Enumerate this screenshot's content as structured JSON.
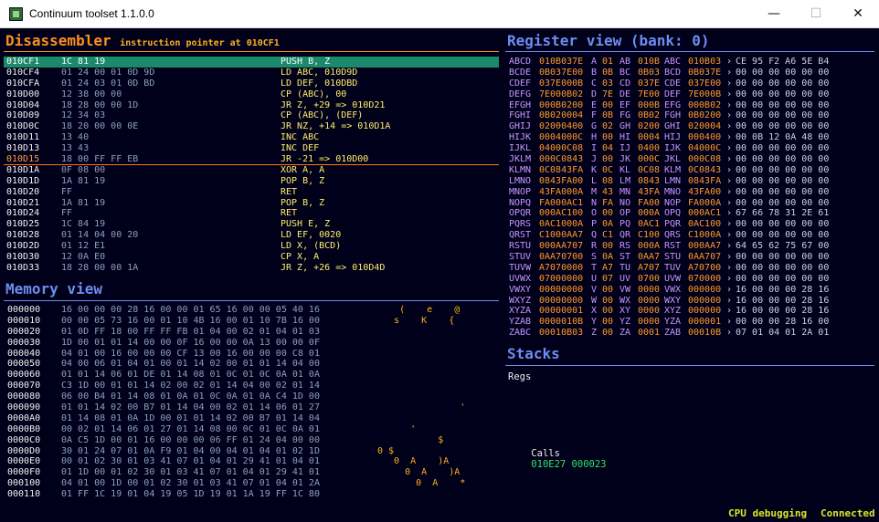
{
  "window": {
    "title": "Continuum toolset 1.1.0.0",
    "minimize_glyph": "—",
    "maximize_glyph": "☐",
    "close_glyph": "✕"
  },
  "disassembler": {
    "title": "Disassembler",
    "subtitle": "instruction pointer at 010CF1",
    "rows": [
      {
        "addr": "010CF1",
        "bytes": "1C 81 19",
        "instr": "PUSH B, Z"
      },
      {
        "addr": "010CF4",
        "bytes": "01 24 00 01 0D 9D",
        "instr": "LD ABC, 010D9D"
      },
      {
        "addr": "010CFA",
        "bytes": "01 24 03 01 0D BD",
        "instr": "LD DEF, 010DBD"
      },
      {
        "addr": "010D00",
        "bytes": "12 38 00 00",
        "instr": "CP (ABC), 00"
      },
      {
        "addr": "010D04",
        "bytes": "18 28 00 00 1D",
        "instr": "JR Z, +29 => 010D21"
      },
      {
        "addr": "010D09",
        "bytes": "12 34 03",
        "instr": "CP (ABC), (DEF)"
      },
      {
        "addr": "010D0C",
        "bytes": "18 20 00 00 0E",
        "instr": "JR NZ, +14 => 010D1A"
      },
      {
        "addr": "010D11",
        "bytes": "13 40",
        "instr": "INC ABC"
      },
      {
        "addr": "010D13",
        "bytes": "13 43",
        "instr": "INC DEF"
      },
      {
        "addr": "010D15",
        "bytes": "18 00 FF FF EB",
        "instr": "JR -21 => 010D00"
      },
      {
        "addr": "010D1A",
        "bytes": "0F 08 00",
        "instr": "XOR A, A"
      },
      {
        "addr": "010D1D",
        "bytes": "1A 81 19",
        "instr": "POP B, Z"
      },
      {
        "addr": "010D20",
        "bytes": "FF",
        "instr": "RET"
      },
      {
        "addr": "010D21",
        "bytes": "1A 81 19",
        "instr": "POP B, Z"
      },
      {
        "addr": "010D24",
        "bytes": "FF",
        "instr": "RET"
      },
      {
        "addr": "010D25",
        "bytes": "1C 84 19",
        "instr": "PUSH E, Z"
      },
      {
        "addr": "010D28",
        "bytes": "01 14 04 00 20",
        "instr": "LD EF, 0020"
      },
      {
        "addr": "010D2D",
        "bytes": "01 12 E1",
        "instr": "LD X, (BCD)"
      },
      {
        "addr": "010D30",
        "bytes": "12 0A E0",
        "instr": "CP X, A"
      },
      {
        "addr": "010D33",
        "bytes": "18 28 00 00 1A",
        "instr": "JR Z, +26 => 010D4D"
      }
    ]
  },
  "memory": {
    "title": "Memory view",
    "rows": [
      {
        "addr": "000000",
        "bytes": "16 00 00 00 28 16 00 00 01 65 16 00 00 05 40 16",
        "ascii": "    (    e    @ "
      },
      {
        "addr": "000010",
        "bytes": "00 00 05 73 16 00 01 10 4B 16 00 01 10 7B 16 00",
        "ascii": "   s    K    {  "
      },
      {
        "addr": "000020",
        "bytes": "01 0D FF 18 00 FF FF FB 01 04 00 02 01 04 01 03",
        "ascii": "                "
      },
      {
        "addr": "000030",
        "bytes": "1D 00 01 01 14 00 00 0F 16 00 00 0A 13 00 00 0F",
        "ascii": "                "
      },
      {
        "addr": "000040",
        "bytes": "04 01 00 16 00 00 00 CF 13 00 16 00 00 00 C8 01",
        "ascii": "                "
      },
      {
        "addr": "000050",
        "bytes": "04 00 06 01 04 01 00 01 14 02 00 01 01 14 04 00",
        "ascii": "                "
      },
      {
        "addr": "000060",
        "bytes": "01 01 14 06 01 DE 01 14 08 01 0C 01 0C 0A 01 0A",
        "ascii": "                "
      },
      {
        "addr": "000070",
        "bytes": "C3 1D 00 01 01 14 02 00 02 01 14 04 00 02 01 14",
        "ascii": "                "
      },
      {
        "addr": "000080",
        "bytes": "06 00 B4 01 14 08 01 0A 01 0C 0A 01 0A C4 1D 00",
        "ascii": "                "
      },
      {
        "addr": "000090",
        "bytes": "01 01 14 02 00 B7 01 14 04 00 02 01 14 06 01 27",
        "ascii": "               '"
      },
      {
        "addr": "0000A0",
        "bytes": "01 14 08 01 0A 1D 00 01 01 14 02 00 B7 01 14 04",
        "ascii": "                "
      },
      {
        "addr": "0000B0",
        "bytes": "00 02 01 14 06 01 27 01 14 08 00 0C 01 0C 0A 01",
        "ascii": "      '         "
      },
      {
        "addr": "0000C0",
        "bytes": "0A C5 1D 00 01 16 00 00 00 06 FF 01 24 04 00 00",
        "ascii": "           $    "
      },
      {
        "addr": "0000D0",
        "bytes": "30 01 24 07 01 0A F9 01 04 00 04 01 04 01 02 1D",
        "ascii": "0 $             "
      },
      {
        "addr": "0000E0",
        "bytes": "00 01 02 30 01 03 41 07 01 04 01 29 41 01 04 01",
        "ascii": "   0  A    )A   "
      },
      {
        "addr": "0000F0",
        "bytes": "01 1D 00 01 02 30 01 03 41 07 01 04 01 29 41 01",
        "ascii": "     0  A    )A "
      },
      {
        "addr": "000100",
        "bytes": "04 01 00 1D 00 01 02 30 01 03 41 07 01 04 01 2A",
        "ascii": "       0  A    *"
      },
      {
        "addr": "000110",
        "bytes": "01 FF 1C 19 01 04 19 05 1D 19 01 1A 19 FF 1C 80",
        "ascii": "                "
      }
    ]
  },
  "registers": {
    "title": "Register view (bank: 0)",
    "rows": [
      {
        "a": "ABCD",
        "av": "010B037E",
        "b": "A",
        "bv": "01",
        "c": "AB",
        "cv": "010B",
        "d": "ABC",
        "dv": "010B03",
        "bin": "CE 95 F2 A6 5E B4"
      },
      {
        "a": "BCDE",
        "av": "0B037E00",
        "b": "B",
        "bv": "0B",
        "c": "BC",
        "cv": "0B03",
        "d": "BCD",
        "dv": "0B037E",
        "bin": "00 00 00 00 00 00"
      },
      {
        "a": "CDEF",
        "av": "037E000B",
        "b": "C",
        "bv": "03",
        "c": "CD",
        "cv": "037E",
        "d": "CDE",
        "dv": "037E00",
        "bin": "00 00 00 00 00 00"
      },
      {
        "a": "DEFG",
        "av": "7E000B02",
        "b": "D",
        "bv": "7E",
        "c": "DE",
        "cv": "7E00",
        "d": "DEF",
        "dv": "7E000B",
        "bin": "00 00 00 00 00 00"
      },
      {
        "a": "EFGH",
        "av": "000B0200",
        "b": "E",
        "bv": "00",
        "c": "EF",
        "cv": "000B",
        "d": "EFG",
        "dv": "000B02",
        "bin": "00 00 00 00 00 00"
      },
      {
        "a": "FGHI",
        "av": "0B020004",
        "b": "F",
        "bv": "0B",
        "c": "FG",
        "cv": "0B02",
        "d": "FGH",
        "dv": "0B0200",
        "bin": "00 00 00 00 00 00"
      },
      {
        "a": "GHIJ",
        "av": "02000400",
        "b": "G",
        "bv": "02",
        "c": "GH",
        "cv": "0200",
        "d": "GHI",
        "dv": "020004",
        "bin": "00 00 00 00 00 00"
      },
      {
        "a": "HIJK",
        "av": "0004000C",
        "b": "H",
        "bv": "00",
        "c": "HI",
        "cv": "0004",
        "d": "HIJ",
        "dv": "000400",
        "bin": "00 0B 12 0A 48 00"
      },
      {
        "a": "IJKL",
        "av": "04000C08",
        "b": "I",
        "bv": "04",
        "c": "IJ",
        "cv": "0400",
        "d": "IJK",
        "dv": "04000C",
        "bin": "00 00 00 00 00 00"
      },
      {
        "a": "JKLM",
        "av": "000C0843",
        "b": "J",
        "bv": "00",
        "c": "JK",
        "cv": "000C",
        "d": "JKL",
        "dv": "000C08",
        "bin": "00 00 00 00 00 00"
      },
      {
        "a": "KLMN",
        "av": "0C0843FA",
        "b": "K",
        "bv": "0C",
        "c": "KL",
        "cv": "0C08",
        "d": "KLM",
        "dv": "0C0843",
        "bin": "00 00 00 00 00 00"
      },
      {
        "a": "LMNO",
        "av": "0843FA00",
        "b": "L",
        "bv": "08",
        "c": "LM",
        "cv": "0843",
        "d": "LMN",
        "dv": "0843FA",
        "bin": "00 00 00 00 00 00"
      },
      {
        "a": "MNOP",
        "av": "43FA000A",
        "b": "M",
        "bv": "43",
        "c": "MN",
        "cv": "43FA",
        "d": "MNO",
        "dv": "43FA00",
        "bin": "00 00 00 00 00 00"
      },
      {
        "a": "NOPQ",
        "av": "FA000AC1",
        "b": "N",
        "bv": "FA",
        "c": "NO",
        "cv": "FA00",
        "d": "NOP",
        "dv": "FA000A",
        "bin": "00 00 00 00 00 00"
      },
      {
        "a": "OPQR",
        "av": "000AC100",
        "b": "O",
        "bv": "00",
        "c": "OP",
        "cv": "000A",
        "d": "OPQ",
        "dv": "000AC1",
        "bin": "67 66 78 31 2E 61"
      },
      {
        "a": "PQRS",
        "av": "0AC1000A",
        "b": "P",
        "bv": "0A",
        "c": "PQ",
        "cv": "0AC1",
        "d": "PQR",
        "dv": "0AC100",
        "bin": "00 00 00 00 00 00"
      },
      {
        "a": "QRST",
        "av": "C1000AA7",
        "b": "Q",
        "bv": "C1",
        "c": "QR",
        "cv": "C100",
        "d": "QRS",
        "dv": "C1000A",
        "bin": "00 00 00 00 00 00"
      },
      {
        "a": "RSTU",
        "av": "000AA707",
        "b": "R",
        "bv": "00",
        "c": "RS",
        "cv": "000A",
        "d": "RST",
        "dv": "000AA7",
        "bin": "64 65 62 75 67 00"
      },
      {
        "a": "STUV",
        "av": "0AA70700",
        "b": "S",
        "bv": "0A",
        "c": "ST",
        "cv": "0AA7",
        "d": "STU",
        "dv": "0AA707",
        "bin": "00 00 00 00 00 00"
      },
      {
        "a": "TUVW",
        "av": "A7070000",
        "b": "T",
        "bv": "A7",
        "c": "TU",
        "cv": "A707",
        "d": "TUV",
        "dv": "A70700",
        "bin": "00 00 00 00 00 00"
      },
      {
        "a": "UVWX",
        "av": "07000000",
        "b": "U",
        "bv": "07",
        "c": "UV",
        "cv": "0700",
        "d": "UVW",
        "dv": "070000",
        "bin": "00 00 00 00 00 00"
      },
      {
        "a": "VWXY",
        "av": "00000000",
        "b": "V",
        "bv": "00",
        "c": "VW",
        "cv": "0000",
        "d": "VWX",
        "dv": "000000",
        "bin": "16 00 00 00 28 16"
      },
      {
        "a": "WXYZ",
        "av": "00000000",
        "b": "W",
        "bv": "00",
        "c": "WX",
        "cv": "0000",
        "d": "WXY",
        "dv": "000000",
        "bin": "16 00 00 00 28 16"
      },
      {
        "a": "XYZA",
        "av": "00000001",
        "b": "X",
        "bv": "00",
        "c": "XY",
        "cv": "0000",
        "d": "XYZ",
        "dv": "000000",
        "bin": "16 00 00 00 28 16"
      },
      {
        "a": "YZAB",
        "av": "0000010B",
        "b": "Y",
        "bv": "00",
        "c": "YZ",
        "cv": "0000",
        "d": "YZA",
        "dv": "000001",
        "bin": "00 00 00 28 16 00"
      },
      {
        "a": "ZABC",
        "av": "00010B03",
        "b": "Z",
        "bv": "00",
        "c": "ZA",
        "cv": "0001",
        "d": "ZAB",
        "dv": "00010B",
        "bin": "07 01 04 01 2A 01"
      }
    ]
  },
  "stacks": {
    "title": "Stacks",
    "regs_label": "Regs",
    "calls_label": "Calls",
    "calls_values": "010E27 000023"
  },
  "status": {
    "debug": "CPU debugging",
    "connection": "Connected"
  },
  "colors": {
    "background": "#00001a",
    "disasm_title": "#ff8f1f",
    "panel_title": "#6e8df0",
    "selection": "#1b8a6a",
    "instruction": "#ffef6b",
    "register_name": "#c597ff",
    "register_value": "#ff9a2a"
  }
}
